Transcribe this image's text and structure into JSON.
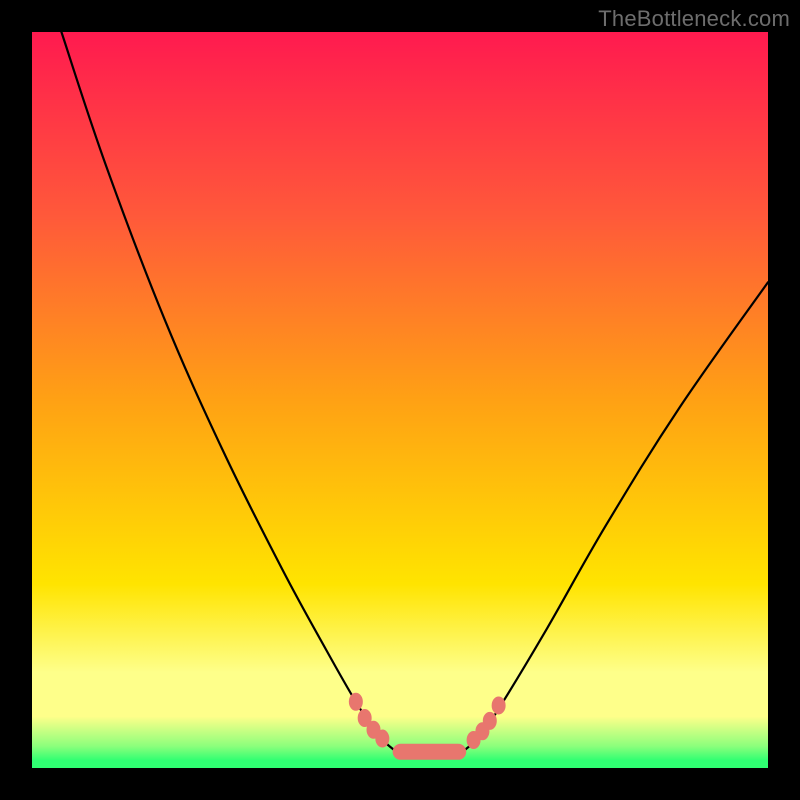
{
  "watermark": "TheBottleneck.com",
  "colors": {
    "top": "#ff1a4f",
    "q1": "#ff593a",
    "mid": "#ffa114",
    "q3": "#ffe400",
    "band_yellow": "#feff8a",
    "band_green": "#8dff7c",
    "line_green": "#2fff72",
    "marker": "#e8766e"
  },
  "chart_data": {
    "type": "line",
    "title": "",
    "xlabel": "",
    "ylabel": "",
    "xlim": [
      0,
      100
    ],
    "ylim": [
      0,
      100
    ],
    "series": [
      {
        "name": "left-curve",
        "x": [
          4,
          10,
          18,
          26,
          34,
          40,
          44,
          47,
          49.5
        ],
        "y": [
          100,
          82,
          61,
          43,
          27,
          16,
          9,
          4.5,
          2.2
        ]
      },
      {
        "name": "flat-bottom",
        "x": [
          49.5,
          58.5
        ],
        "y": [
          2.2,
          2.2
        ]
      },
      {
        "name": "right-curve",
        "x": [
          58.5,
          61,
          64,
          70,
          78,
          88,
          100
        ],
        "y": [
          2.2,
          4.5,
          9,
          19,
          33,
          49,
          66
        ]
      }
    ],
    "markers": {
      "name": "highlight-dots",
      "points": [
        {
          "x": 44.0,
          "y": 9.0
        },
        {
          "x": 45.2,
          "y": 6.8
        },
        {
          "x": 46.4,
          "y": 5.2
        },
        {
          "x": 47.6,
          "y": 4.0
        },
        {
          "x": 60.0,
          "y": 3.8
        },
        {
          "x": 61.2,
          "y": 5.0
        },
        {
          "x": 62.2,
          "y": 6.4
        },
        {
          "x": 63.4,
          "y": 8.5
        }
      ],
      "pill": {
        "x0": 49.0,
        "x1": 59.0,
        "y": 2.2
      }
    }
  }
}
